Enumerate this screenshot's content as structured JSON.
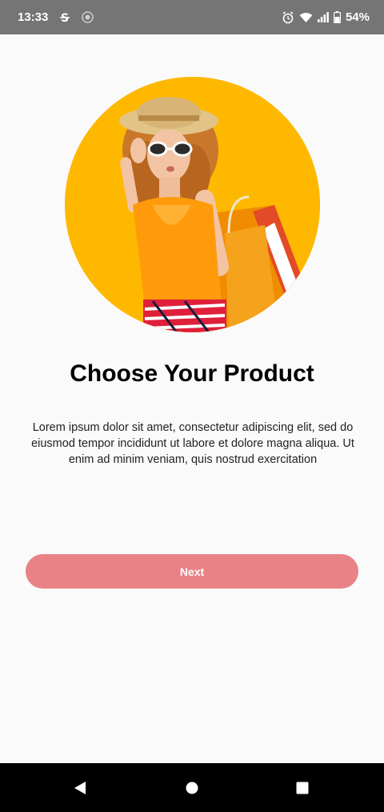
{
  "status_bar": {
    "time": "13:33",
    "battery": "54%",
    "icons": [
      "s-icon",
      "app-icon",
      "alarm-icon",
      "wifi-icon",
      "signal-icon",
      "battery-icon"
    ]
  },
  "onboarding": {
    "title": "Choose Your Product",
    "description": "Lorem ipsum dolor sit amet, consectetur adipiscing elit, sed do eiusmod tempor incididunt ut labore et dolore magna aliqua. Ut enim ad minim veniam, quis nostrud exercitation",
    "next_label": "Next",
    "hero_image": "woman-with-shopping-bags"
  },
  "colors": {
    "accent": "#e98286",
    "hero_bg": "#ffb700",
    "status_bar": "#757575",
    "nav_bar": "#000000"
  },
  "nav_bar": {
    "icons": [
      "back-icon",
      "home-icon",
      "recents-icon"
    ]
  }
}
